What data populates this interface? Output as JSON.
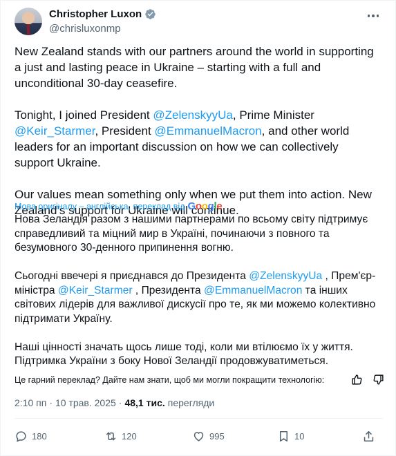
{
  "author": {
    "name": "Christopher Luxon",
    "handle": "@chrisluxonmp"
  },
  "original": {
    "p1": "New Zealand stands with our partners around the world in supporting a just and lasting peace in Ukraine – starting with a full and unconditional 30-day ceasefire.",
    "p2_a": "Tonight, I joined President ",
    "p2_m1": "@ZelenskyyUa",
    "p2_b": ", Prime Minister ",
    "p2_m2": "@Keir_Starmer",
    "p2_c": ", President ",
    "p2_m3": "@EmmanuelMacron",
    "p2_d": ", and other world leaders for an important discussion on how we can collectively support Ukraine.",
    "p3": "Our values mean something only when we put them into action. New Zealand’s support for Ukraine will continue."
  },
  "translation_notice": {
    "text": "Мова оригіналу – англійська, переклад від",
    "google": "Google"
  },
  "translation": {
    "p1": "Нова Зеландія разом з нашими партнерами по всьому світу підтримує справедливий та міцний мир в Україні, починаючи з повного та безумовного 30-денного припинення вогню.",
    "p2_a": "Сьогодні ввечері я приєднався до Президента ",
    "p2_m1": "@ZelenskyyUa",
    "p2_b": " , Прем'єр-міністра ",
    "p2_m2": "@Keir_Starmer",
    "p2_c": " , Президента ",
    "p2_m3": "@EmmanuelMacron",
    "p2_d": " та інших світових лідерів для важливої дискусії про те, як ми можемо колективно підтримати Україну.",
    "p3": "Наші цінності значать щось лише тоді, коли ми втілюємо їх у життя. Підтримка України з боку Нової Зеландії продовжуватиметься."
  },
  "feedback": {
    "text": "Це гарний переклад? Дайте нам знати, щоб ми могли покращити технологію:"
  },
  "meta": {
    "time": "2:10 пп",
    "separator": "·",
    "date": "10 трав. 2025",
    "views_count": "48,1 тис.",
    "views_label": "перегляди"
  },
  "actions": {
    "replies": "180",
    "retweets": "120",
    "likes": "995",
    "bookmarks": "10"
  },
  "colors": {
    "accent": "#1d9bf0",
    "text": "#0f1419",
    "secondary": "#536471"
  },
  "icons": [
    "verified-icon",
    "more-icon",
    "thumbs-up-icon",
    "thumbs-down-icon",
    "reply-icon",
    "retweet-icon",
    "like-icon",
    "bookmark-icon",
    "share-icon"
  ]
}
